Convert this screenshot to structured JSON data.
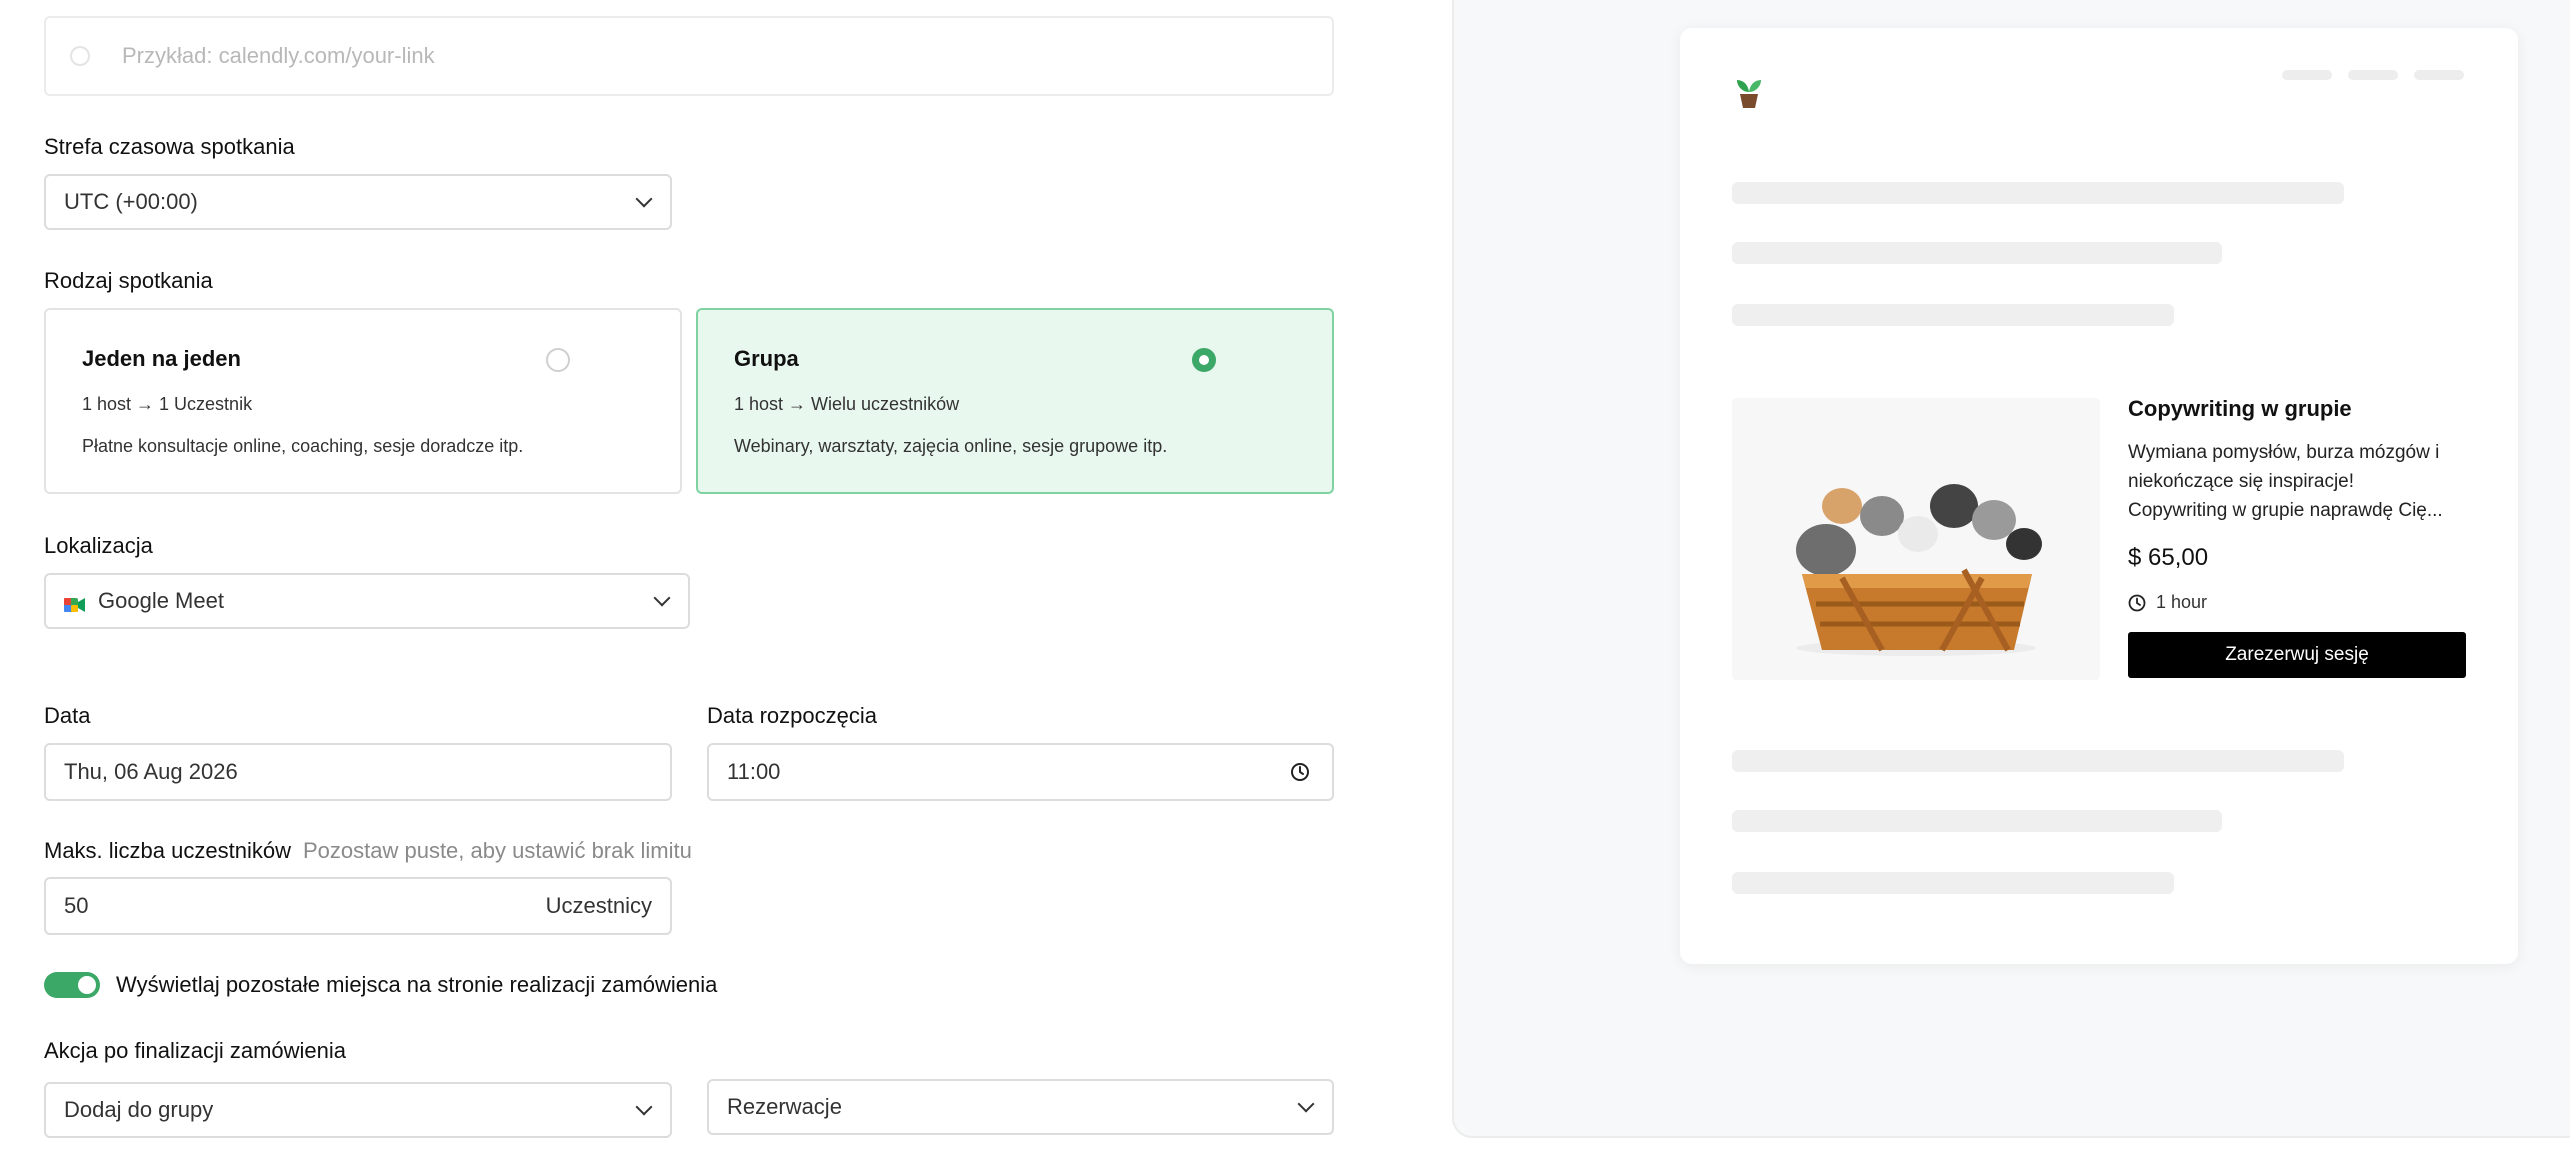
{
  "form": {
    "booking_link_placeholder": "Przykład: calendly.com/your-link",
    "timezone": {
      "label": "Strefa czasowa spotkania",
      "value": "UTC (+00:00)"
    },
    "meeting_type": {
      "label": "Rodzaj spotkania",
      "options": [
        {
          "title": "Jeden na jeden",
          "subtitle": "1 host → 1 Uczestnik",
          "description": "Płatne konsultacje online, coaching, sesje doradcze itp.",
          "selected": false
        },
        {
          "title": "Grupa",
          "subtitle": "1 host → Wielu uczestników",
          "description": "Webinary, warsztaty, zajęcia online, sesje grupowe itp.",
          "selected": true
        }
      ]
    },
    "location": {
      "label": "Lokalizacja",
      "value": "Google Meet"
    },
    "date": {
      "label": "Data",
      "value": "Thu, 06 Aug 2026"
    },
    "start_time": {
      "label": "Data rozpoczęcia",
      "value": "11:00"
    },
    "max_participants": {
      "label": "Maks. liczba uczestników",
      "hint": "Pozostaw puste, aby ustawić brak limitu",
      "value": "50",
      "suffix": "Uczestnicy"
    },
    "show_remaining": {
      "label": "Wyświetlaj pozostałe miejsca na stronie realizacji zamówienia",
      "enabled": true
    },
    "post_checkout": {
      "label": "Akcja po finalizacji zamówienia",
      "action": "Dodaj do grupy",
      "target": "Rezerwacje"
    }
  },
  "preview": {
    "product": {
      "title": "Copywriting w grupie",
      "description_lines": [
        "Wymiana pomysłów, burza mózgów i",
        "niekończące się inspiracje!",
        "Copywriting w grupie naprawdę Cię..."
      ],
      "price": "$ 65,00",
      "duration": "1 hour",
      "button_label": "Zarezerwuj sesję"
    }
  },
  "colors": {
    "accent": "#3ca867",
    "selected_bg": "#e9f8ef",
    "selected_border": "#7fd3a0",
    "button": "#000000"
  },
  "icons": {
    "location": "google-meet-icon",
    "time": "clock-icon",
    "brand": "plant-logo-icon"
  }
}
